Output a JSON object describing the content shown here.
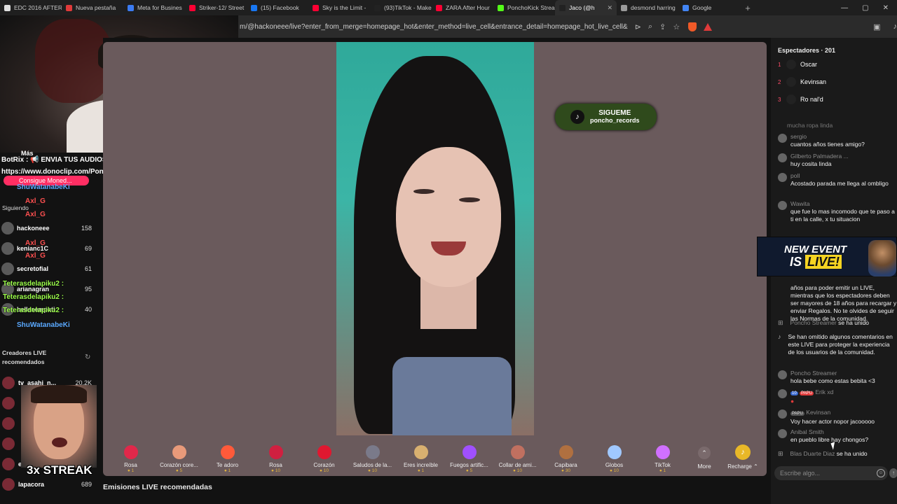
{
  "tabs": [
    {
      "label": "EDC 2016 AFTER",
      "color": "#e0e0e0"
    },
    {
      "label": "Nueva pestaña",
      "color": "#e03a3a"
    },
    {
      "label": "Meta for Busines",
      "color": "#3b7bf2"
    },
    {
      "label": "Striker-12/ Street",
      "color": "#ff0033"
    },
    {
      "label": "(15) Facebook",
      "color": "#1877f2"
    },
    {
      "label": "Sky is the Limit -",
      "color": "#ff0033"
    },
    {
      "label": "(93)TikTok - Make",
      "color": "#222222"
    },
    {
      "label": "ZARA After Hour",
      "color": "#ff0033"
    },
    {
      "label": "PonchoKick Strea",
      "color": "#53fc18"
    },
    {
      "label": "Jaco (@h",
      "color": "#222222",
      "active": true
    },
    {
      "label": "desmond harring",
      "color": "#9a9a9a"
    },
    {
      "label": "Google",
      "color": "#4285f4"
    }
  ],
  "address": {
    "url": "m/@hackoneee/live?enter_from_merge=homepage_hot&enter_method=live_cell&entrance_detail=homepage_hot_live_cell&from..."
  },
  "left_chat": {
    "more": "Más",
    "bot_line1": "BotRix : 📢 ENVIA TUS AUDIOS Y VIDEOS GRATIS →",
    "bot_line2": "https://www.donoclip.com/PonchoKick 📢",
    "coin_button": "Consigue Moned...",
    "name_shu1": "ShuWatanabeKi",
    "following": "Siguiendo",
    "axl1": "Axl_G",
    "axl2": "Axl_G",
    "axl3": "Axl_G",
    "axl4": "Axl_G",
    "teteras1": "Teterasdelapiku2 :",
    "teteras2": "Teterasdelapiku2 :",
    "teteras3": "Teterasdelapiku2 :",
    "shu2": "ShuWatanabeKi"
  },
  "following_list": [
    {
      "name": "hackoneee",
      "count": "158"
    },
    {
      "name": "kenianc1C",
      "count": "69"
    },
    {
      "name": "secretofial",
      "count": "61"
    },
    {
      "name": "arianagran",
      "count": "95"
    },
    {
      "name": "bellasempati",
      "count": "40"
    }
  ],
  "recommended": {
    "title": "Creadores LIVE recomendados",
    "rows": [
      {
        "name": "tv_asahi_n...",
        "count": "20.2K"
      },
      {
        "name": "",
        "count": ""
      },
      {
        "name": "",
        "count": ""
      },
      {
        "name": "",
        "count": ""
      },
      {
        "name": "ernil.rs",
        "count": "6"
      },
      {
        "name": "lapacora",
        "count": "689"
      }
    ],
    "streak": "3x STREAK"
  },
  "overlay_badge": {
    "line1": "SIGUEME",
    "line2": "poncho_records"
  },
  "gifts": [
    {
      "name": "Rosa",
      "price": "1",
      "color": "#e0284a"
    },
    {
      "name": "Corazón core...",
      "price": "5",
      "color": "#e89a7a"
    },
    {
      "name": "Te adoro",
      "price": "1",
      "color": "#ff5a3a"
    },
    {
      "name": "Rosa",
      "price": "10",
      "color": "#d02040"
    },
    {
      "name": "Corazón",
      "price": "10",
      "color": "#e01830"
    },
    {
      "name": "Saludos de la...",
      "price": "10",
      "color": "#7a7a8a"
    },
    {
      "name": "Eres increíble",
      "price": "1",
      "color": "#d8b070"
    },
    {
      "name": "Fuegos artific...",
      "price": "5",
      "color": "#a050ff"
    },
    {
      "name": "Collar de ami...",
      "price": "10",
      "color": "#c07060"
    },
    {
      "name": "Capibara",
      "price": "30",
      "color": "#b07040"
    },
    {
      "name": "Globos",
      "price": "10",
      "color": "#a0c8ff"
    },
    {
      "name": "TikTok",
      "price": "1",
      "color": "#d070ff"
    }
  ],
  "more_label": "More",
  "recharge_label": "Recharge",
  "recommended_streams_title": "Emisiones LIVE recomendadas",
  "chat_panel": {
    "viewers_title": "Espectadores · 201",
    "viewers": [
      {
        "rank": "1",
        "name": "Oscar"
      },
      {
        "rank": "2",
        "name": "Kevinsan"
      },
      {
        "rank": "3",
        "name": "Ro nal'd"
      }
    ],
    "faded_line": "mucha ropa linda",
    "messages": [
      {
        "user": "sergio",
        "text": "cuantos años tienes amigo?"
      },
      {
        "user": "Gilberto Palmadera ...",
        "text": "huy cosita linda"
      },
      {
        "user": "poll",
        "text": "Acostado parada me llega al ombligo"
      },
      {
        "user": "Wawita",
        "text": "que fue lo mas incomodo que te paso a ti en la calle, x tu situacion"
      }
    ],
    "rules_text": "años para poder emitir un LIVE, mientras que los espectadores deben ser mayores de 18 años para recargar y enviar Regalos. No te olvides de seguir las Normas de la comunidad.",
    "joined1_user": "Poncho Streamer",
    "joined1_text": "se ha unido",
    "omitted_text": "Se han omitido algunos comentarios en este LIVE para proteger la experiencia de los usuarios de la comunidad.",
    "msg5_user": "Poncho Streamer",
    "msg5_text": "hola bebe como estas bebita <3",
    "badge_lvl": "10",
    "badge_papu": "PAPU",
    "msg6_user": "Erik xd",
    "msg7_badge": "PAPU",
    "msg7_user": "Kevinsan",
    "msg7_text": "Voy hacer actor nopor jacooooo",
    "msg8_user": "Anibal Smith",
    "msg8_text": "en pueblo libre hay chongos?",
    "joined2_user": "Blas Duarte Diaz",
    "joined2_text": "se ha unido",
    "input_placeholder": "Escribe algo..."
  },
  "event_banner": {
    "line1": "NEW EVENT",
    "line2_is": "IS",
    "line2_live": "LIVE!"
  }
}
